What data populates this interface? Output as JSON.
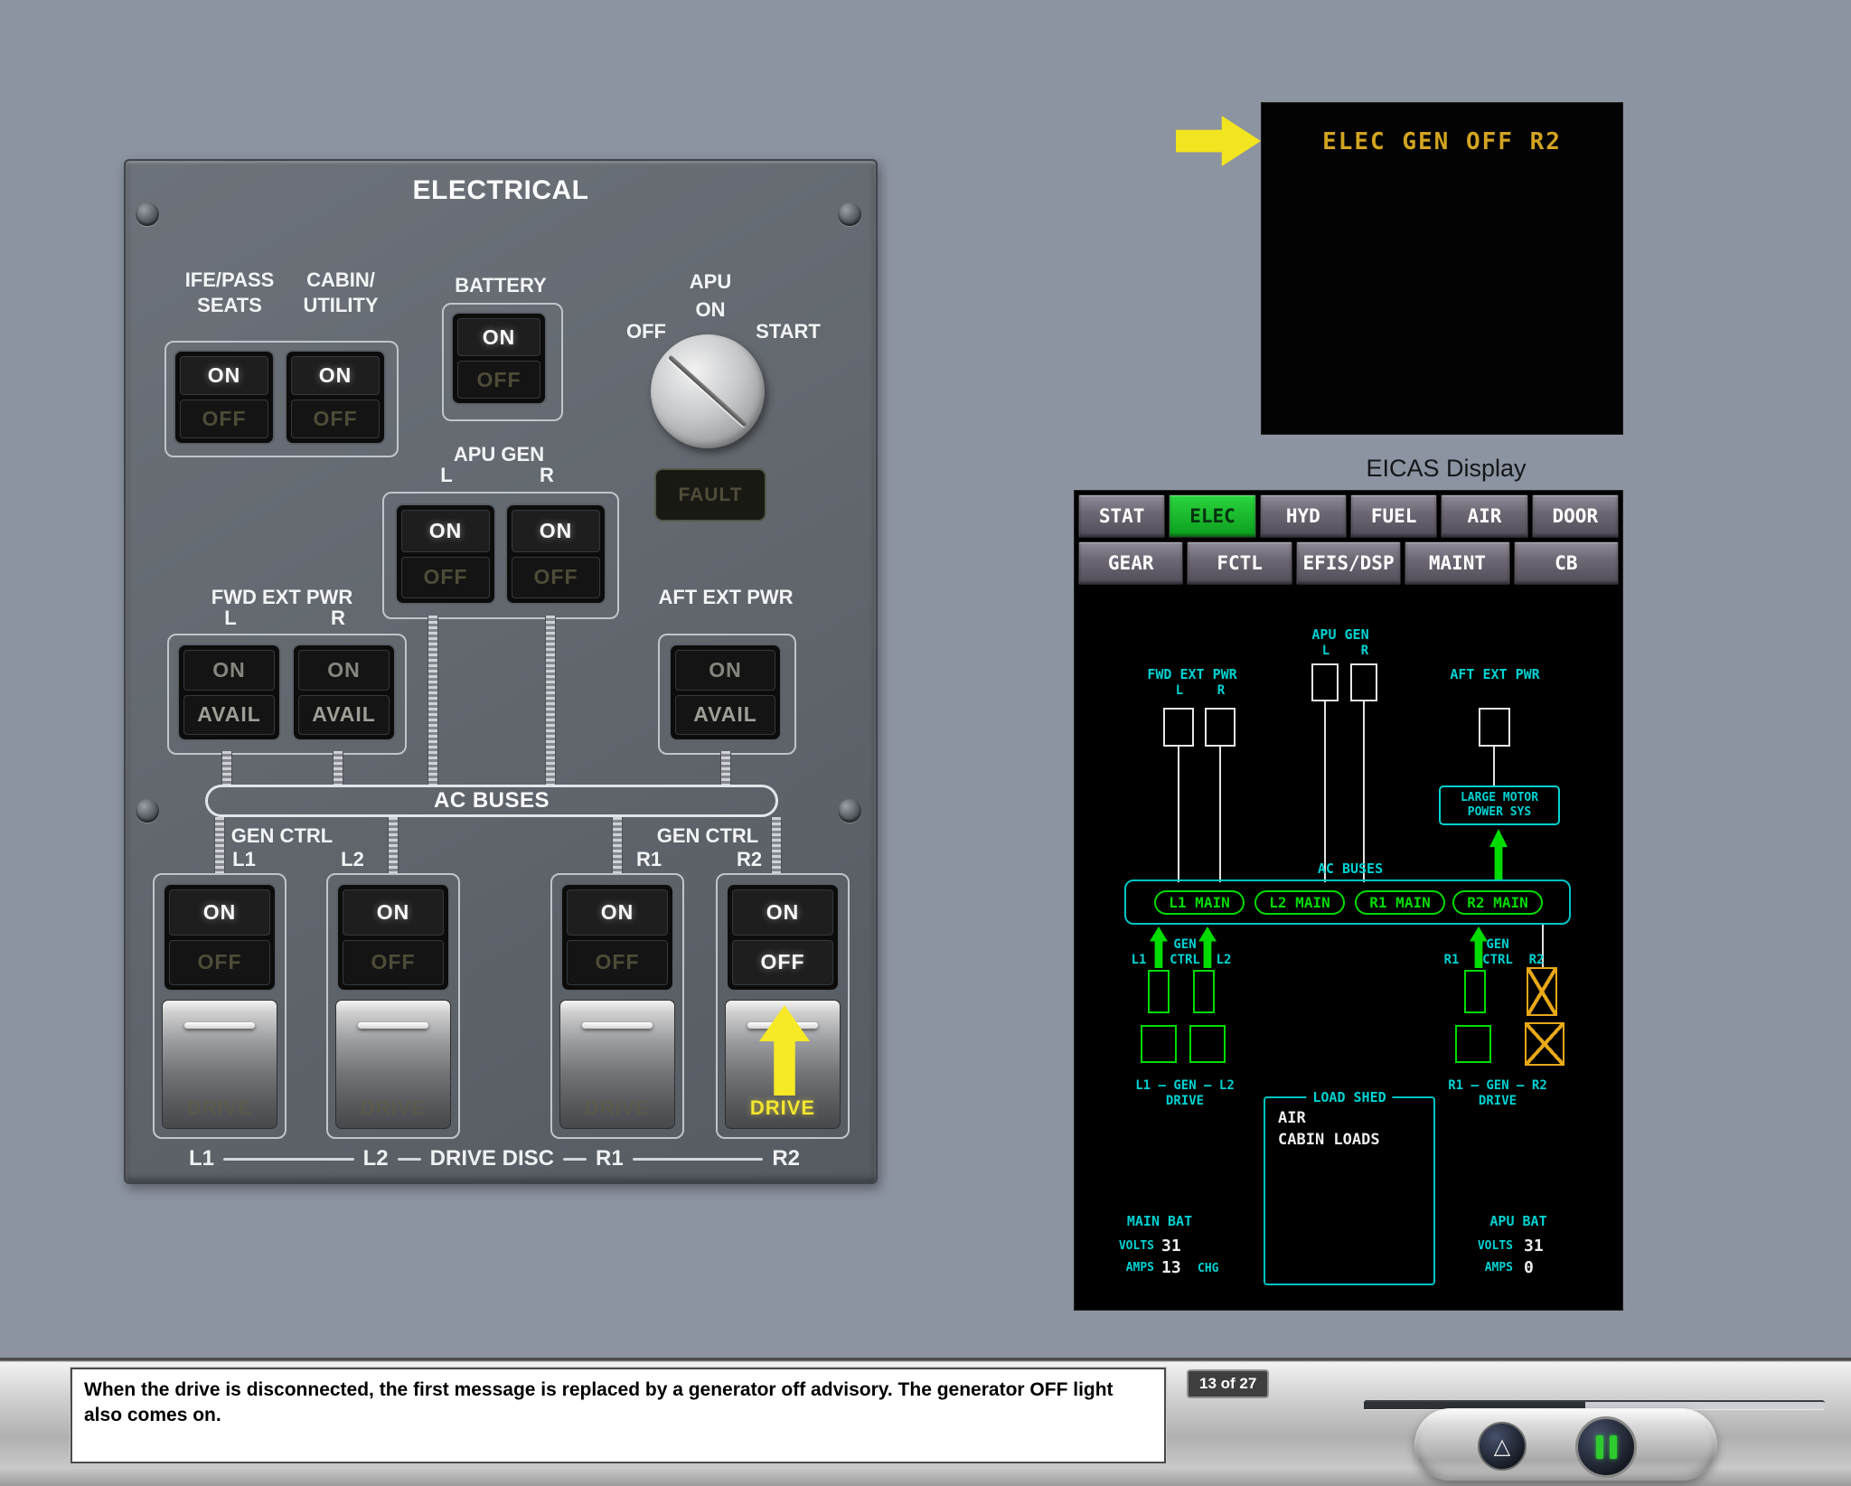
{
  "page": {
    "bg": "#8c93a1"
  },
  "colors": {
    "eicas_cyan": "#00d2d2",
    "eicas_green": "#00dc00",
    "eicas_amber": "#e8a818",
    "advisory_amber": "#d2a422",
    "selected_tab_green": "#12b52c",
    "callout_yellow": "#f2e41e",
    "lit_legend_white": "#fafafa"
  },
  "icons": {
    "eject": "△"
  },
  "panel": {
    "title": "ELECTRICAL",
    "labels": {
      "ife_line1": "IFE/PASS",
      "ife_line2": "SEATS",
      "cabin_line1": "CABIN/",
      "cabin_line2": "UTILITY",
      "battery": "BATTERY",
      "apu": "APU",
      "apu_on": "ON",
      "apu_off": "OFF",
      "apu_start": "START",
      "fault": "FAULT",
      "apu_gen": "APU GEN",
      "fwd_ext_pwr": "FWD EXT PWR",
      "aft_ext_pwr": "AFT EXT PWR",
      "ac_buses": "AC BUSES",
      "gen_ctrl": "GEN CTRL",
      "l": "L",
      "r": "R",
      "l1": "L1",
      "l2": "L2",
      "r1": "R1",
      "r2": "R2",
      "drive_disc": "DRIVE DISC"
    },
    "switch_legends": {
      "on": "ON",
      "off": "OFF",
      "avail": "AVAIL",
      "drive": "DRIVE"
    }
  },
  "advisory": {
    "message": "ELEC GEN OFF R2"
  },
  "eicas": {
    "caption": "EICAS Display",
    "selected_tab": "ELEC",
    "tabs_row1": [
      "STAT",
      "ELEC",
      "HYD",
      "FUEL",
      "AIR",
      "DOOR"
    ],
    "tabs_row2": [
      "GEAR",
      "FCTL",
      "EFIS/DSP",
      "MAINT",
      "CB"
    ],
    "syn": {
      "apu_gen": "APU GEN",
      "fwd_ext_pwr": "FWD EXT PWR",
      "aft_ext_pwr": "AFT EXT PWR",
      "large_motor_1": "LARGE MOTOR",
      "large_motor_2": "POWER SYS",
      "ac_buses": "AC BUSES",
      "buses": [
        "L1 MAIN",
        "L2 MAIN",
        "R1 MAIN",
        "R2 MAIN"
      ],
      "gen": "GEN",
      "ctrl": "CTRL",
      "l": "L",
      "r": "R",
      "l1": "L1",
      "l2": "L2",
      "r1": "R1",
      "r2": "R2",
      "l_drive_line": "L1 – GEN – L2",
      "r_drive_line": "R1 – GEN – R2",
      "drive": "DRIVE",
      "load_shed": "LOAD SHED",
      "load_air": "AIR",
      "load_cabin": "CABIN LOADS",
      "main_bat": "MAIN BAT",
      "apu_bat": "APU BAT",
      "volts": "VOLTS",
      "amps": "AMPS",
      "main_volts": "31",
      "main_amps": "13",
      "chg": "CHG",
      "apu_volts": "31",
      "apu_amps": "0"
    }
  },
  "footer": {
    "caption": "When the drive is disconnected, the first message is replaced by a generator off advisory. The generator OFF light also comes on.",
    "page_indicator": "13 of 27"
  }
}
